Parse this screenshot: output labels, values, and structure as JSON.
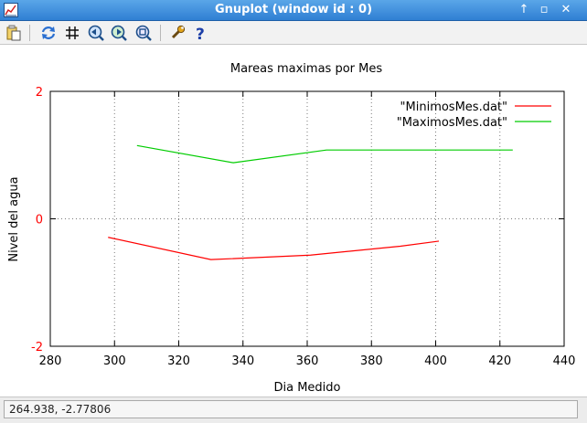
{
  "window": {
    "title": "Gnuplot (window id : 0)",
    "controls": {
      "up": "↑",
      "restore": "▫",
      "close": "✕"
    }
  },
  "toolbar": {
    "items": [
      "copy-to-clipboard",
      "replot",
      "toggle-grid",
      "previous-zoom",
      "next-zoom",
      "autoscale",
      "options",
      "help"
    ]
  },
  "status": {
    "coords": "264.938, -2.77806"
  },
  "colors": {
    "minimos": "#ff0000",
    "maximos": "#00cc00",
    "tick_red": "#ff0000"
  },
  "chart_data": {
    "type": "line",
    "title": "Mareas maximas por Mes",
    "xlabel": "Dia Medido",
    "ylabel": "Nivel del agua",
    "xlim": [
      280,
      440
    ],
    "ylim": [
      -2,
      2
    ],
    "x_ticks": [
      "280",
      "300",
      "320",
      "340",
      "360",
      "380",
      "400",
      "420",
      "440"
    ],
    "y_ticks": [
      "-2",
      "0",
      "2"
    ],
    "grid": true,
    "legend_position": "top-right",
    "series": [
      {
        "name": "\"MinimosMes.dat\"",
        "color": "#ff0000",
        "x": [
          298,
          330,
          361,
          389,
          401
        ],
        "y": [
          -0.29,
          -0.64,
          -0.57,
          -0.43,
          -0.35
        ]
      },
      {
        "name": "\"MaximosMes.dat\"",
        "color": "#00cc00",
        "x": [
          307,
          337,
          366,
          424
        ],
        "y": [
          1.15,
          0.88,
          1.08,
          1.08
        ]
      }
    ]
  }
}
